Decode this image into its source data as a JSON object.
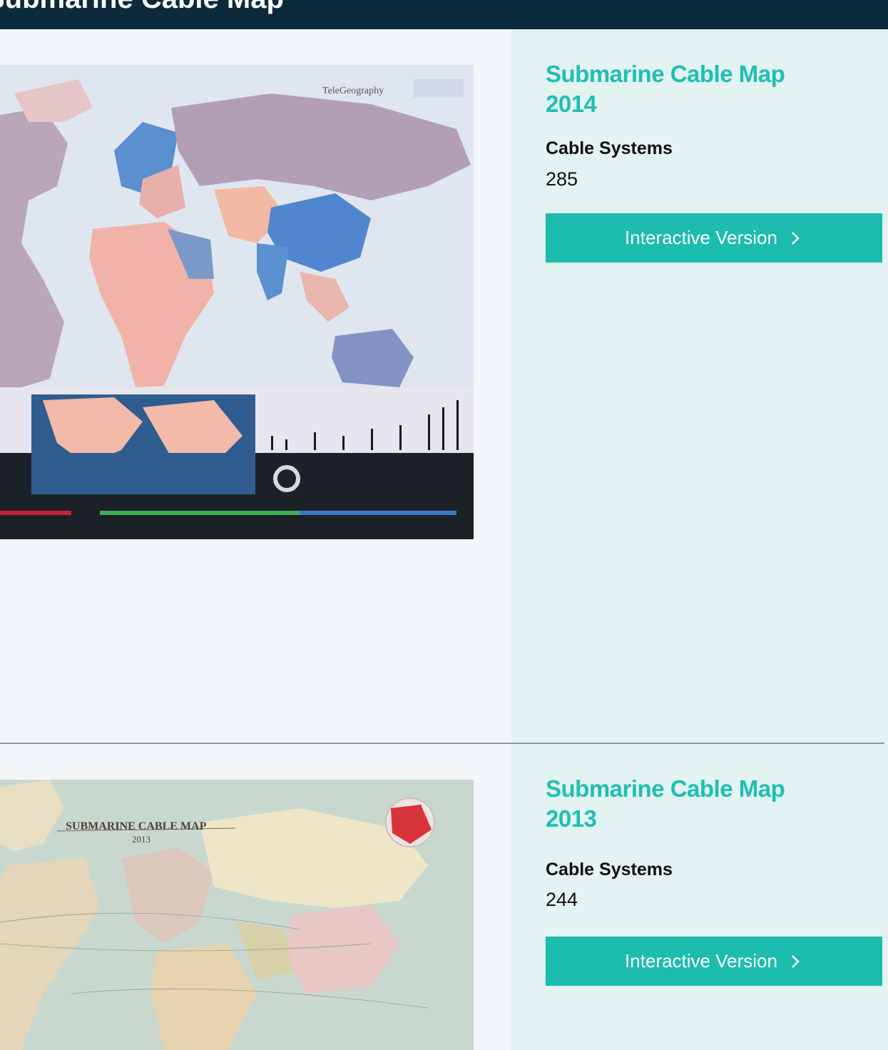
{
  "header": {
    "title": "Submarine Cable Map"
  },
  "entries": [
    {
      "title": "Submarine Cable Map 2014",
      "stat_label": "Cable Systems",
      "stat_value": "285",
      "button_label": "Interactive Version",
      "button_icon": "chevron-right-icon",
      "thumbnail": "world-political-map-2014"
    },
    {
      "title": "Submarine Cable Map 2013",
      "stat_label": "Cable Systems",
      "stat_value": "244",
      "button_label": "Interactive Version",
      "button_icon": "chevron-right-icon",
      "thumbnail": "vintage-world-map-2013"
    }
  ],
  "colors": {
    "header_bg": "#0b2a3b",
    "accent": "#1cbcae",
    "title_color": "#1fbfb2",
    "panel_bg": "#e2f3f1"
  }
}
